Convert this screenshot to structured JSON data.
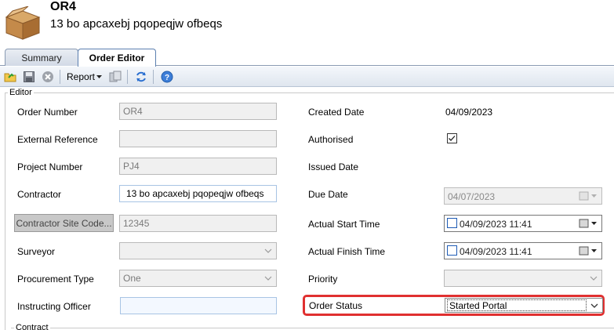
{
  "header": {
    "title": "OR4",
    "subtitle": "13 bo apcaxebj pqopeqjw ofbeqs"
  },
  "tabs": [
    {
      "label": "Summary"
    },
    {
      "label": "Order Editor"
    }
  ],
  "toolbar": {
    "report_label": "Report"
  },
  "editor": {
    "legend": "Editor",
    "contract_legend": "Contract",
    "left": {
      "order_number_label": "Order Number",
      "order_number_value": "OR4",
      "external_reference_label": "External Reference",
      "external_reference_value": "",
      "project_number_label": "Project Number",
      "project_number_value": "PJ4",
      "contractor_label": "Contractor",
      "contractor_value": "13 bo apcaxebj pqopeqjw ofbeqs",
      "contractor_site_code_button": "Contractor Site Code...",
      "contractor_site_code_value": "12345",
      "surveyor_label": "Surveyor",
      "surveyor_value": "",
      "procurement_type_label": "Procurement Type",
      "procurement_type_value": "One",
      "instructing_officer_label": "Instructing Officer",
      "instructing_officer_value": ""
    },
    "right": {
      "created_date_label": "Created Date",
      "created_date_value": "04/09/2023",
      "authorised_label": "Authorised",
      "authorised_checked": true,
      "issued_date_label": "Issued Date",
      "due_date_label": "Due Date",
      "due_date_value": "04/07/2023",
      "actual_start_label": "Actual Start Time",
      "actual_start_value": "04/09/2023 11:41",
      "actual_finish_label": "Actual Finish Time",
      "actual_finish_value": "04/09/2023 11:41",
      "priority_label": "Priority",
      "priority_value": "",
      "order_status_label": "Order Status",
      "order_status_value": "Started Portal"
    }
  },
  "colors": {
    "highlight": "#e03030",
    "tab_border": "#5b7fb0"
  }
}
